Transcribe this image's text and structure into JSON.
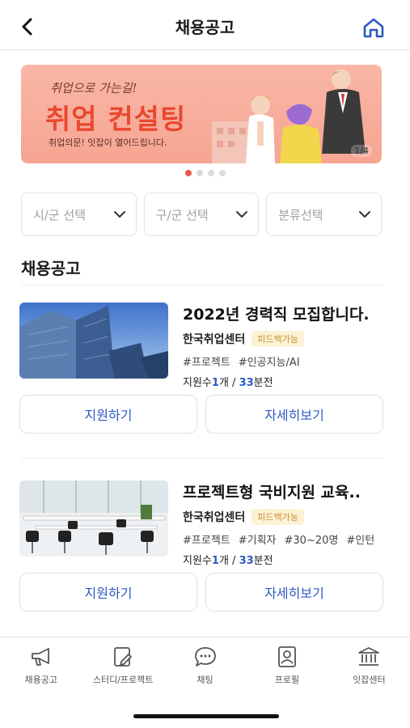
{
  "header": {
    "title": "채용공고"
  },
  "banner": {
    "sub": "취업으로 가는길!",
    "main": "취업 컨설팅",
    "desc": "취업의문! 잇잡이 열어드립니다.",
    "counter": "1/4"
  },
  "carousel": {
    "count": 4,
    "active": 1
  },
  "filters": [
    {
      "label": "시/군 선택"
    },
    {
      "label": "구/군 선택"
    },
    {
      "label": "분류선택"
    }
  ],
  "section": {
    "title": "채용공고"
  },
  "jobs": [
    {
      "title": "2022년 경력직 모집합니다.",
      "company": "한국취업센터",
      "badge": "피드백가능",
      "tags": [
        "#프로젝트",
        "#인공지능/AI"
      ],
      "stats": {
        "applicants_label": "지원수",
        "applicants": "1",
        "applicants_unit": "개 /",
        "time": "33",
        "time_unit": "분전"
      },
      "apply_label": "지원하기",
      "detail_label": "자세히보기"
    },
    {
      "title": "프로젝트형 국비지원 교육..",
      "company": "한국취업센터",
      "badge": "피드백가능",
      "tags": [
        "#프로젝트",
        "#기획자",
        "#30~20명",
        "#인턴"
      ],
      "stats": {
        "applicants_label": "지원수",
        "applicants": "1",
        "applicants_unit": "개 /",
        "time": "33",
        "time_unit": "분전"
      },
      "apply_label": "지원하기",
      "detail_label": "자세히보기"
    }
  ],
  "nav": [
    {
      "label": "채용공고",
      "icon": "megaphone-icon"
    },
    {
      "label": "스터디/프로젝트",
      "icon": "study-icon"
    },
    {
      "label": "채팅",
      "icon": "chat-icon"
    },
    {
      "label": "프로필",
      "icon": "profile-icon"
    },
    {
      "label": "잇잡센터",
      "icon": "center-icon"
    }
  ],
  "colors": {
    "accent": "#2b59c3",
    "banner": "#f6a592",
    "banner_text": "#e9482f",
    "badge_text": "#c9912a",
    "badge_bg": "#fdf2d6"
  }
}
